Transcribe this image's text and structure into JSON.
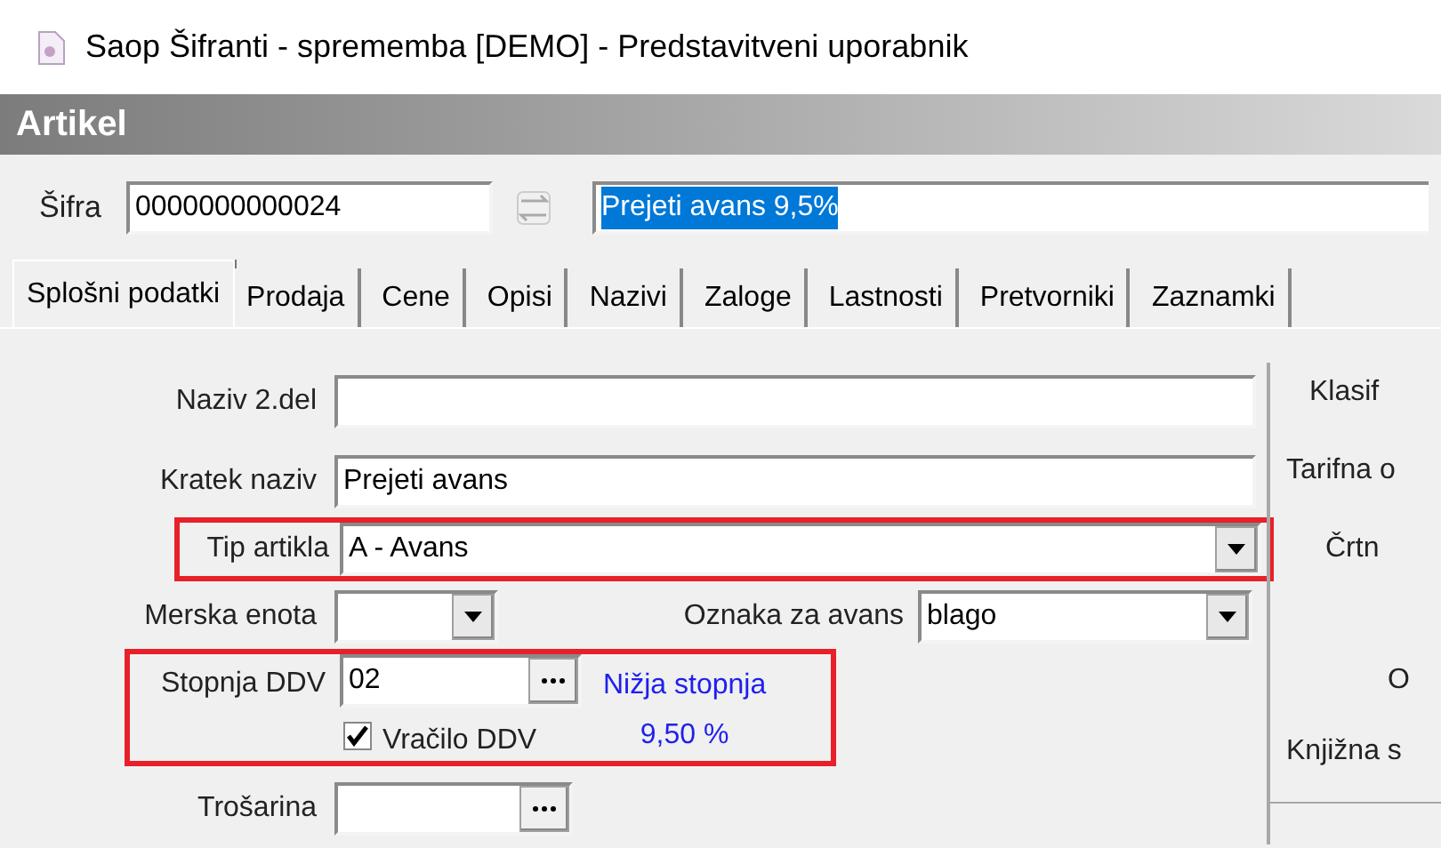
{
  "window": {
    "title": "Saop Šifranti - sprememba [DEMO] - Predstavitveni uporabnik"
  },
  "header": {
    "title": "Artikel"
  },
  "code": {
    "label": "Šifra",
    "value": "0000000000024"
  },
  "name": {
    "value": "Prejeti avans 9,5%",
    "selected": true
  },
  "tabs": [
    {
      "label": "Splošni podatki",
      "selected": true
    },
    {
      "label": "Prodaja",
      "selected": false
    },
    {
      "label": "Cene",
      "selected": false
    },
    {
      "label": "Opisi",
      "selected": false
    },
    {
      "label": "Nazivi",
      "selected": false
    },
    {
      "label": "Zaloge",
      "selected": false
    },
    {
      "label": "Lastnosti",
      "selected": false
    },
    {
      "label": "Pretvorniki",
      "selected": false
    },
    {
      "label": "Zaznamki",
      "selected": false
    }
  ],
  "form": [
    {
      "kind": "text",
      "label": "Naziv 2.del",
      "highlighted": false
    },
    {
      "kind": "text",
      "label": "Kratek naziv",
      "value": "Prejeti avans",
      "highlighted": false
    },
    {
      "kind": "combo",
      "label": "Tip artikla",
      "value": "A - Avans",
      "highlighted": true
    },
    {
      "kind": "combo_pair",
      "label": "Merska enota",
      "second_label": "Oznaka za avans",
      "second_value": "blago",
      "highlighted": false
    },
    {
      "kind": "vat",
      "label": "Stopnja DDV",
      "value": "02",
      "rate_name": "Nižja stopnja",
      "rate_value": "9,50 %",
      "checkbox_label": "Vračilo DDV",
      "checked": true,
      "highlighted": true
    },
    {
      "kind": "lookup",
      "label": "Trošarina",
      "highlighted": false
    }
  ],
  "right_labels": [
    "Klasif",
    "Tarifna o",
    "Črtn",
    "O",
    "Knjižna s"
  ]
}
